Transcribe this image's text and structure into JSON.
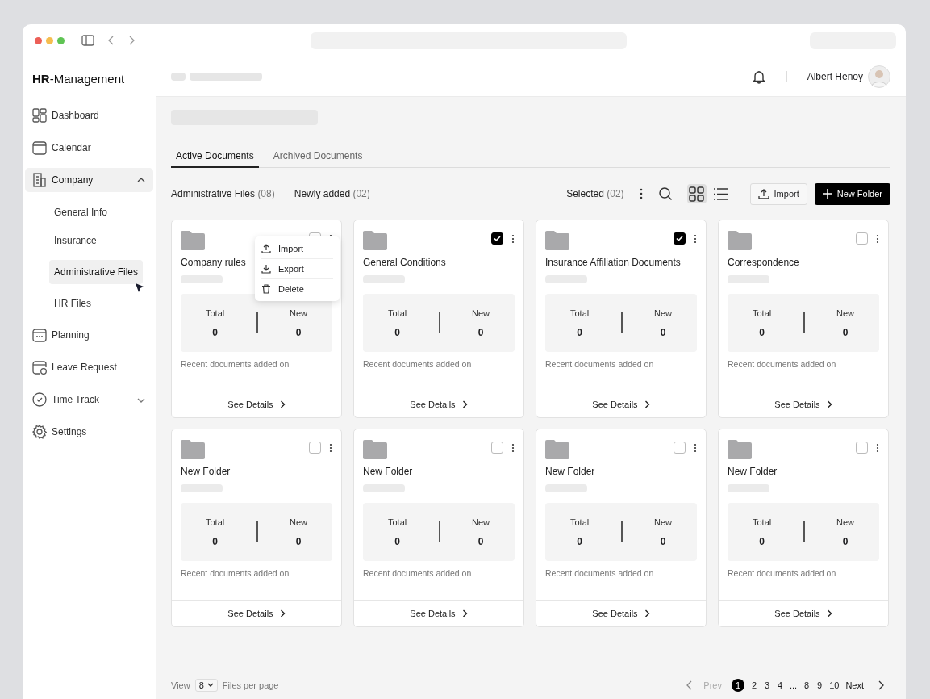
{
  "sidebar": {
    "logo": "**HR**-Management",
    "items": [
      {
        "label": "Dashboard",
        "selected": false
      },
      {
        "label": "Calendar",
        "selected": false
      },
      {
        "label": "Company",
        "selected": true,
        "expanded": true,
        "children": [
          {
            "label": "General Info",
            "selected": false
          },
          {
            "label": "Insurance",
            "selected": false
          },
          {
            "label": "Administrative Files",
            "selected": true
          },
          {
            "label": "HR Files",
            "selected": false
          }
        ]
      },
      {
        "label": "Planning",
        "selected": false
      },
      {
        "label": "Leave Request",
        "selected": false
      },
      {
        "label": "Time Track",
        "selected": false,
        "expanded": false
      },
      {
        "label": "Settings",
        "selected": false
      }
    ]
  },
  "header": {
    "user": "Albert Henoy"
  },
  "tabs": [
    {
      "label": "Active Documents",
      "selected": true
    },
    {
      "label": "Archived Documents",
      "selected": false
    }
  ],
  "filters": [
    {
      "label": "Administrative Files",
      "count": "(08)"
    },
    {
      "label": "Newly added",
      "count": "(02)"
    }
  ],
  "selection": {
    "label": "Selected",
    "count": "(02)"
  },
  "views": [
    {
      "kind": "grid",
      "selected": true
    },
    {
      "kind": "list",
      "selected": false
    }
  ],
  "import_button": "Import",
  "new_folder_button": "New Folder",
  "cards": [
    {
      "title": "Company rules",
      "checked": false,
      "total_label": "Total",
      "total": "0",
      "new_label": "New",
      "new": "0",
      "recent": "Recent documents added on",
      "details": "See Details"
    },
    {
      "title": "General Conditions",
      "checked": true,
      "total_label": "Total",
      "total": "0",
      "new_label": "New",
      "new": "0",
      "recent": "Recent documents added on",
      "details": "See Details"
    },
    {
      "title": "Insurance Affiliation Documents",
      "checked": true,
      "total_label": "Total",
      "total": "0",
      "new_label": "New",
      "new": "0",
      "recent": "Recent documents added on",
      "details": "See Details"
    },
    {
      "title": "Correspondence",
      "checked": false,
      "total_label": "Total",
      "total": "0",
      "new_label": "New",
      "new": "0",
      "recent": "Recent documents added on",
      "details": "See Details"
    },
    {
      "title": "New Folder",
      "checked": false,
      "total_label": "Total",
      "total": "0",
      "new_label": "New",
      "new": "0",
      "recent": "Recent documents added on",
      "details": "See Details"
    },
    {
      "title": "New Folder",
      "checked": false,
      "total_label": "Total",
      "total": "0",
      "new_label": "New",
      "new": "0",
      "recent": "Recent documents added on",
      "details": "See Details"
    },
    {
      "title": "New Folder",
      "checked": false,
      "total_label": "Total",
      "total": "0",
      "new_label": "New",
      "new": "0",
      "recent": "Recent documents added on",
      "details": "See Details"
    },
    {
      "title": "New Folder",
      "checked": false,
      "total_label": "Total",
      "total": "0",
      "new_label": "New",
      "new": "0",
      "recent": "Recent documents added on",
      "details": "See Details"
    }
  ],
  "context_menu": {
    "items": [
      {
        "label": "Import"
      },
      {
        "label": "Export"
      },
      {
        "label": "Delete"
      }
    ]
  },
  "footer": {
    "view_label": "View",
    "per_page": "8",
    "per_page_suffix": "Files per page"
  },
  "pagination": {
    "prev": "Prev",
    "prev_disabled": true,
    "pages": [
      {
        "label": "1",
        "selected": true
      },
      {
        "label": "2",
        "selected": false
      },
      {
        "label": "3",
        "selected": false
      },
      {
        "label": "4",
        "selected": false
      },
      {
        "label": "...",
        "selected": false
      },
      {
        "label": "8",
        "selected": false
      },
      {
        "label": "9",
        "selected": false
      },
      {
        "label": "10",
        "selected": false
      }
    ],
    "next": "Next"
  }
}
